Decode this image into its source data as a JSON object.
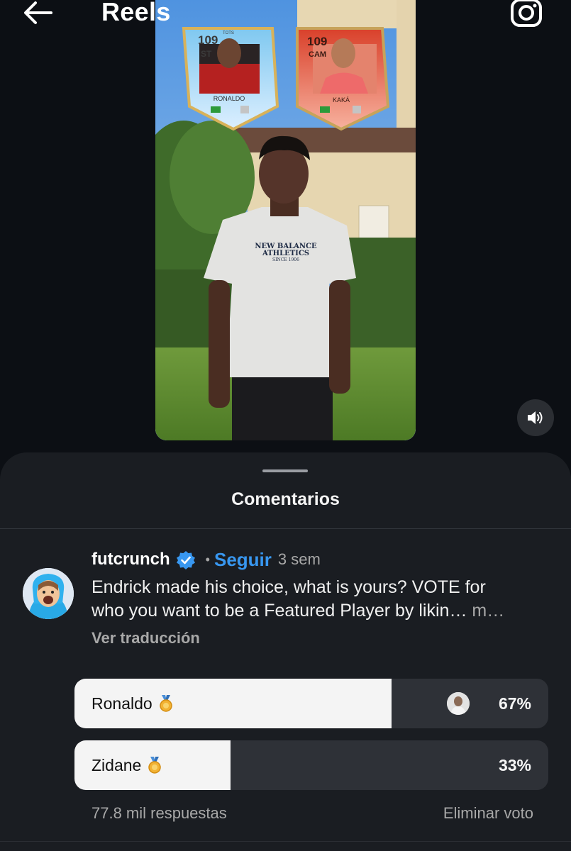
{
  "topbar": {
    "title": "Reels"
  },
  "video": {
    "card_left": {
      "rating": "109",
      "position": "ST",
      "program": "TOTS",
      "name": "RONALDO"
    },
    "card_right": {
      "rating": "109",
      "position": "CAM",
      "name": "KAKÁ"
    },
    "shirt_text": [
      "NEW BALANCE",
      "ATHLETICS",
      "SINCE 1906"
    ]
  },
  "comments": {
    "title": "Comentarios",
    "post": {
      "username": "futcrunch",
      "separator": "•",
      "follow_label": "Seguir",
      "time": "3 sem",
      "caption_line1": "Endrick made his choice, what is yours? VOTE for",
      "caption_line2": "who you want to be a Featured Player by likin…",
      "more_label": "m…",
      "translate_label": "Ver traducción"
    },
    "poll": {
      "options": [
        {
          "label": "Ronaldo",
          "percent_text": "67%",
          "percent": 67,
          "selected": true
        },
        {
          "label": "Zidane",
          "percent_text": "33%",
          "percent": 33,
          "selected": false
        }
      ],
      "responses": "77.8 mil respuestas",
      "remove_vote_label": "Eliminar voto"
    }
  },
  "colors": {
    "background": "#0c0f14",
    "sheet": "#1a1d22",
    "link": "#3897f0",
    "verified": "#3897f0"
  },
  "icons": [
    "back-arrow-icon",
    "camera-icon",
    "speaker-icon",
    "verified-badge-icon",
    "medal-icon"
  ]
}
